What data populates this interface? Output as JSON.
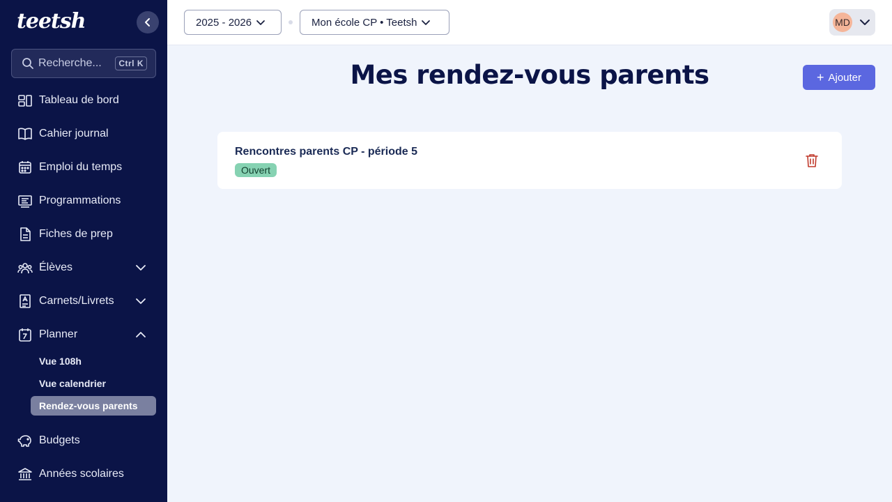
{
  "sidebar": {
    "logo_text": "teetsh",
    "search": {
      "placeholder": "Recherche...",
      "shortcut": "Ctrl K"
    },
    "items": [
      {
        "label": "Tableau de bord",
        "icon": "dashboard-icon"
      },
      {
        "label": "Cahier journal",
        "icon": "book-open-icon"
      },
      {
        "label": "Emploi du temps",
        "icon": "calendar-icon"
      },
      {
        "label": "Programmations",
        "icon": "list-panel-icon"
      },
      {
        "label": "Fiches de prep",
        "icon": "file-text-icon"
      },
      {
        "label": "Élèves",
        "icon": "users-icon",
        "expandable": true,
        "expanded": false
      },
      {
        "label": "Carnets/Livrets",
        "icon": "notebook-icon",
        "expandable": true,
        "expanded": false
      },
      {
        "label": "Planner",
        "icon": "planner-icon",
        "expandable": true,
        "expanded": true
      },
      {
        "label": "Budgets",
        "icon": "piggy-bank-icon"
      },
      {
        "label": "Années scolaires",
        "icon": "bank-icon"
      }
    ],
    "planner_sub": [
      {
        "label": "Vue 108h",
        "active": false
      },
      {
        "label": "Vue calendrier",
        "active": false
      },
      {
        "label": "Rendez-vous parents",
        "active": true
      }
    ]
  },
  "header": {
    "year_select": "2025 - 2026",
    "school_select": "Mon école CP • Teetsh",
    "user_initials": "MD"
  },
  "main": {
    "title": "Mes rendez-vous parents",
    "add_label": "Ajouter",
    "meetings": [
      {
        "title": "Rencontres parents CP - période 5",
        "status": "Ouvert"
      }
    ]
  },
  "colors": {
    "sidebar_bg": "#0b1447",
    "accent": "#5b67e0",
    "status_open": "#86d2b2",
    "danger": "#c0392b"
  }
}
